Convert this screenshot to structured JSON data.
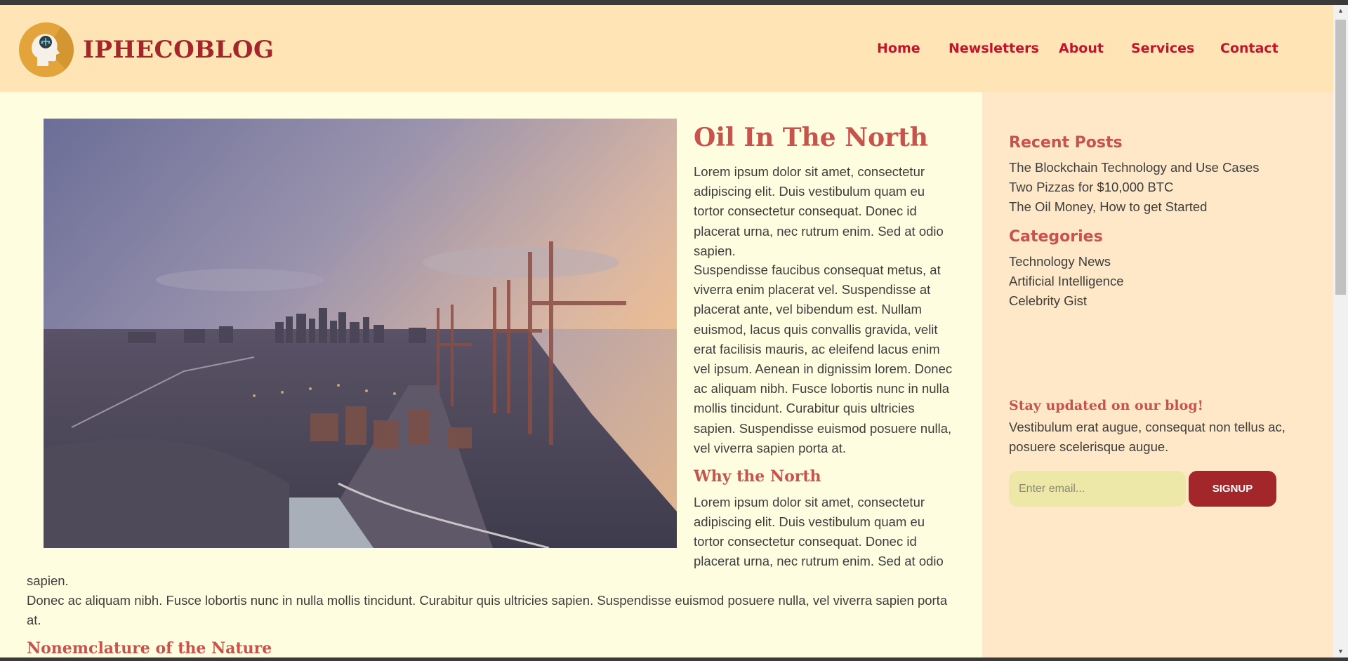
{
  "brand": {
    "name": "IPHECOBLOG",
    "logo_icon": "head-with-scales-icon"
  },
  "nav": [
    "Home",
    "Newsletters",
    "About",
    "Services",
    "Contact"
  ],
  "article": {
    "title": "Oil In The North",
    "paragraph_1": "Lorem ipsum dolor sit amet, consectetur adipiscing elit. Duis vestibulum quam eu tortor consectetur consequat. Donec id placerat urna, nec rutrum enim. Sed at odio sapien.",
    "paragraph_2": "Suspendisse faucibus consequat metus, at viverra enim placerat vel. Suspendisse at placerat ante, vel bibendum est. Nullam euismod, lacus quis convallis gravida, velit erat facilisis mauris, ac eleifend lacus enim vel ipsum. Aenean in dignissim lorem. Donec ac aliquam nibh. Fusce lobortis nunc in nulla mollis tincidunt. Curabitur quis ultricies sapien. Suspendisse euismod posuere nulla, vel viverra sapien porta at.",
    "subtitle_1": "Why the North",
    "paragraph_3_lines": [
      "Lorem ipsum dolor sit amet, consectetur",
      "adipiscing elit. Duis vestibulum quam eu",
      "tortor consectetur consequat. Donec id",
      "placerat urna, nec rutrum enim. Sed at odio",
      "sapien."
    ],
    "paragraph_4": "Donec ac aliquam nibh. Fusce lobortis nunc in nulla mollis tincidunt. Curabitur quis ultricies sapien. Suspendisse euismod posuere nulla, vel viverra sapien porta at.",
    "subtitle_2": "Nonemclature of the Nature"
  },
  "sidebar": {
    "recent_title": "Recent Posts",
    "recent_posts": [
      "The Blockchain Technology and Use Cases",
      "Two Pizzas for $10,000 BTC",
      "The Oil Money, How to get Started"
    ],
    "categories_title": "Categories",
    "categories": [
      "Technology News",
      "Artificial Intelligence",
      "Celebrity Gist"
    ],
    "newsletter_title": "Stay updated on our blog!",
    "newsletter_text": "Vestibulum erat augue, consequat non tellus ac, posuere scelerisque augue.",
    "email_placeholder": "Enter email...",
    "signup_label": "SIGNUP"
  },
  "colors": {
    "header_bg": "#ffe5b5",
    "main_bg": "#fffde0",
    "sidebar_bg": "#ffe8c8",
    "accent": "#a3262a",
    "heading": "#c7534d",
    "nav_link": "#c0162c"
  }
}
